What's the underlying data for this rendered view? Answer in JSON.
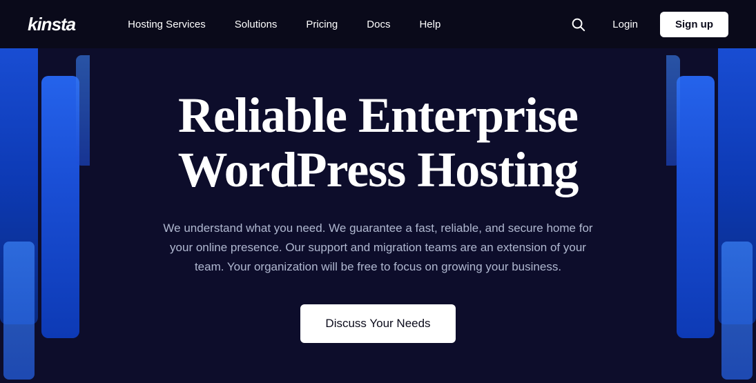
{
  "navbar": {
    "logo": "kinsta",
    "links": [
      {
        "label": "Hosting Services",
        "id": "hosting-services"
      },
      {
        "label": "Solutions",
        "id": "solutions"
      },
      {
        "label": "Pricing",
        "id": "pricing"
      },
      {
        "label": "Docs",
        "id": "docs"
      },
      {
        "label": "Help",
        "id": "help"
      }
    ],
    "login_label": "Login",
    "signup_label": "Sign up",
    "search_aria": "Search"
  },
  "hero": {
    "title_line1": "Reliable Enterprise",
    "title_line2": "WordPress Hosting",
    "subtitle": "We understand what you need. We guarantee a fast, reliable, and secure home for your online presence. Our support and migration teams are an extension of your team. Your organization will be free to focus on growing your business.",
    "cta_label": "Discuss Your Needs"
  },
  "colors": {
    "navbar_bg": "#0a0a1a",
    "hero_bg": "#0d0d2b",
    "hero_text": "#ffffff",
    "hero_subtitle": "#b0b8d0",
    "cta_bg": "#ffffff",
    "cta_text": "#0a0a1a",
    "blue_col": "#1a4fd6"
  }
}
